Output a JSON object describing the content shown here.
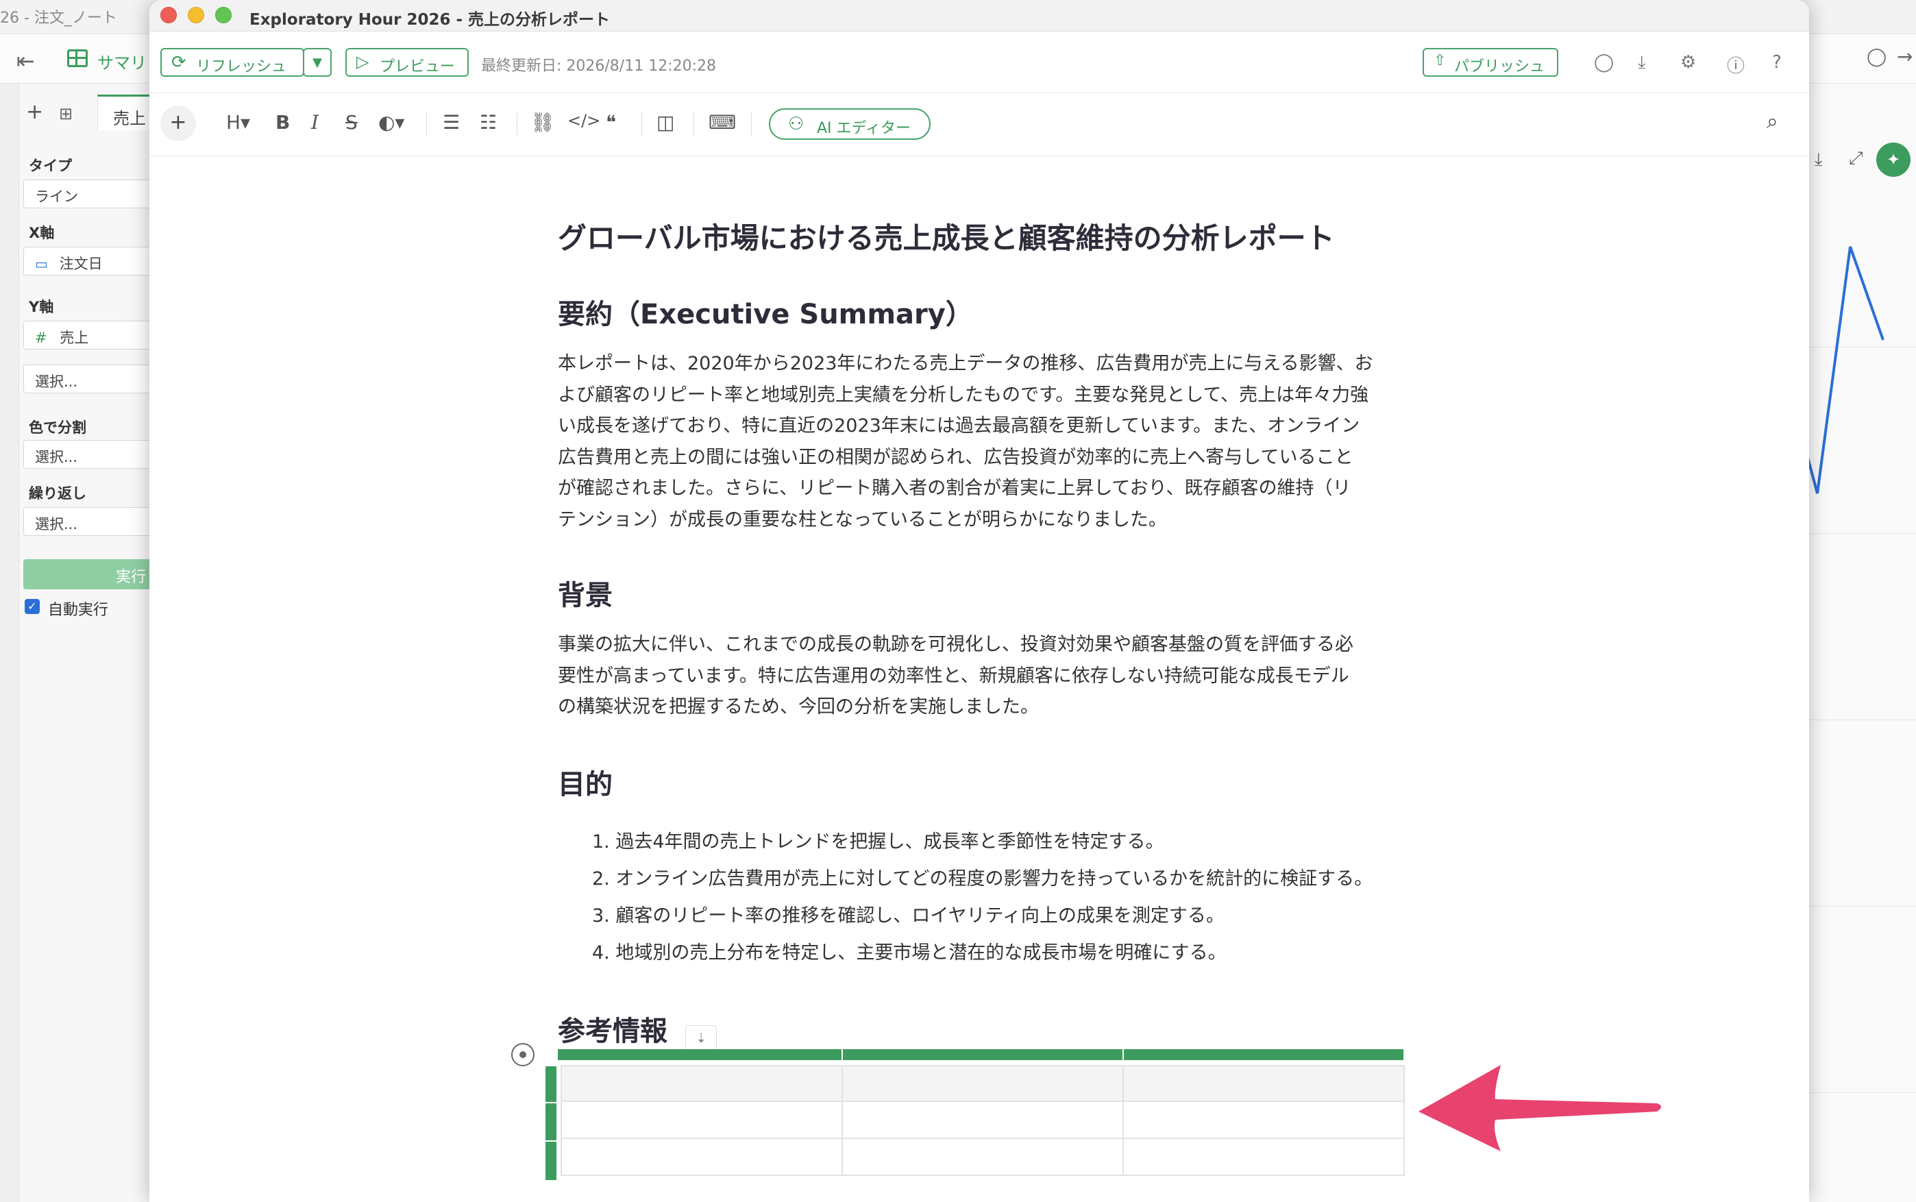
{
  "background": {
    "title": "26 - 注文_ノート",
    "summary_label": "サマリ",
    "tab_label": "売上",
    "fields": {
      "type_label": "タイプ",
      "type_value": "ライン",
      "x_label": "X軸",
      "x_value": "注文日",
      "y_label": "Y軸",
      "y_value": "売上",
      "y_extra_placeholder": "選択...",
      "color_label": "色で分割",
      "color_placeholder": "選択...",
      "repeat_label": "繰り返し",
      "repeat_placeholder": "選択..."
    },
    "run_label": "実行",
    "auto_run_label": "自動実行",
    "auto_run_checked": true
  },
  "window": {
    "title": "Exploratory Hour 2026 - 売上の分析レポート",
    "toolbar": {
      "refresh_label": "リフレッシュ",
      "preview_label": "プレビュー",
      "last_updated": "最終更新日: 2026/8/11 12:20:28",
      "publish_label": "パブリッシュ"
    },
    "editor_toolbar": {
      "ai_editor_label": "AI エディター"
    }
  },
  "document": {
    "title": "グローバル市場における売上成長と顧客維持の分析レポート",
    "sections": [
      {
        "heading": "要約（Executive Summary）",
        "lines": [
          "本レポートは、2020年から2023年にわたる売上データの推移、広告費用が売上に与える影響、お",
          "よび顧客のリピート率と地域別売上実績を分析したものです。主要な発見として、売上は年々力強",
          "い成長を遂げており、特に直近の2023年末には過去最高額を更新しています。また、オンライン",
          "広告費用と売上の間には強い正の相関が認められ、広告投資が効率的に売上へ寄与していること",
          "が確認されました。さらに、リピート購入者の割合が着実に上昇しており、既存顧客の維持（リ",
          "テンション）が成長の重要な柱となっていることが明らかになりました。"
        ]
      },
      {
        "heading": "背景",
        "lines": [
          "事業の拡大に伴い、これまでの成長の軌跡を可視化し、投資対効果や顧客基盤の質を評価する必",
          "要性が高まっています。特に広告運用の効率性と、新規顧客に依存しない持続可能な成長モデル",
          "の構築状況を把握するため、今回の分析を実施しました。"
        ]
      },
      {
        "heading": "目的",
        "items": [
          "1. 過去4年間の売上トレンドを把握し、成長率と季節性を特定する。",
          "2. オンライン広告費用が売上に対してどの程度の影響力を持っているかを統計的に検証する。",
          "3. 顧客のリピート率の推移を確認し、ロイヤリティ向上の成果を測定する。",
          "4. 地域別の売上分布を特定し、主要市場と潜在的な成長市場を明確にする。"
        ]
      },
      {
        "heading": "参考情報"
      }
    ],
    "table": {
      "rows": 3,
      "cols": 3
    }
  },
  "colors": {
    "accent": "#3c9c5e",
    "arrow": "#e8426e"
  }
}
